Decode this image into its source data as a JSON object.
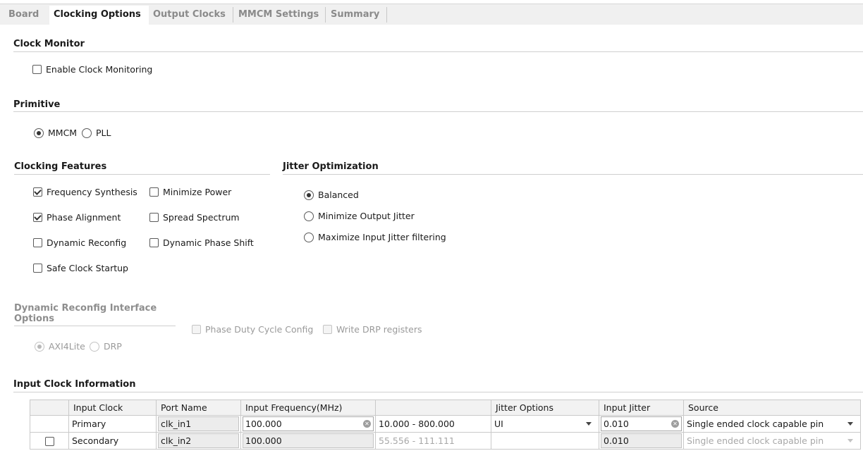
{
  "tabs": [
    {
      "label": "Board"
    },
    {
      "label": "Clocking Options"
    },
    {
      "label": "Output Clocks"
    },
    {
      "label": "MMCM Settings"
    },
    {
      "label": "Summary"
    }
  ],
  "clock_monitor": {
    "title": "Clock Monitor",
    "enable_label": "Enable Clock Monitoring",
    "enabled": false
  },
  "primitive": {
    "title": "Primitive",
    "options": [
      {
        "label": "MMCM",
        "selected": true
      },
      {
        "label": "PLL",
        "selected": false
      }
    ]
  },
  "clocking_features": {
    "title": "Clocking Features",
    "items": [
      {
        "label": "Frequency Synthesis",
        "checked": true
      },
      {
        "label": "Minimize Power",
        "checked": false
      },
      {
        "label": "Phase Alignment",
        "checked": true
      },
      {
        "label": "Spread Spectrum",
        "checked": false
      },
      {
        "label": "Dynamic Reconfig",
        "checked": false
      },
      {
        "label": "Dynamic Phase Shift",
        "checked": false
      },
      {
        "label": "Safe Clock Startup",
        "checked": false
      }
    ]
  },
  "jitter_optimization": {
    "title": "Jitter Optimization",
    "options": [
      {
        "label": "Balanced",
        "selected": true
      },
      {
        "label": "Minimize Output Jitter",
        "selected": false
      },
      {
        "label": "Maximize Input Jitter filtering",
        "selected": false
      }
    ]
  },
  "dynamic_reconfig": {
    "title_line1": "Dynamic Reconfig Interface",
    "title_line2": "Options",
    "options": [
      {
        "label": "Phase Duty Cycle Config",
        "checked": false
      },
      {
        "label": "Write DRP registers",
        "checked": false
      }
    ],
    "interface": [
      {
        "label": "AXI4Lite",
        "selected": true
      },
      {
        "label": "DRP",
        "selected": false
      }
    ]
  },
  "input_clock": {
    "title": "Input Clock Information",
    "headers": [
      "Input Clock",
      "Port Name",
      "Input Frequency(MHz)",
      "",
      "Jitter Options",
      "Input Jitter",
      "Source"
    ],
    "rows": [
      {
        "checked": null,
        "input_clock": "Primary",
        "port_name": "clk_in1",
        "frequency": "100.000",
        "range": "10.000 - 800.000",
        "jitter_option": "UI",
        "input_jitter": "0.010",
        "source": "Single ended clock capable pin"
      },
      {
        "checked": false,
        "input_clock": "Secondary",
        "port_name": "clk_in2",
        "frequency": "100.000",
        "range": "55.556 - 111.111",
        "jitter_option": "",
        "input_jitter": "0.010",
        "source": "Single ended clock capable pin"
      }
    ]
  }
}
